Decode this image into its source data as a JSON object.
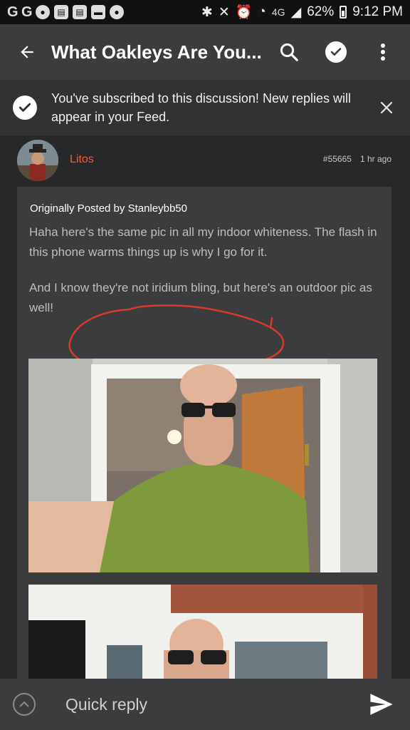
{
  "status_bar": {
    "left_letters": [
      "G",
      "G"
    ],
    "notification_icons": [
      "b",
      "reddit-icon",
      "calendar-icon",
      "calendar-icon",
      "message-icon",
      "reddit-icon"
    ],
    "network_label": "4G",
    "battery": "62%",
    "time": "9:12 PM"
  },
  "app_bar": {
    "title": "What Oakleys Are You...",
    "icons": [
      "back-arrow-icon",
      "search-icon",
      "check-circle-icon",
      "more-vert-icon"
    ]
  },
  "banner": {
    "text": "You've subscribed to this discussion! New replies will appear in your Feed."
  },
  "post": {
    "username": "Litos",
    "post_number": "#55665",
    "time_ago": "1 hr ago",
    "quote": {
      "author_line": "Originally Posted by Stanleybb50",
      "paragraph1": "Haha here's the same pic in all my indoor whiteness. The flash in this phone warms things up is why I go for it.",
      "paragraph2": "And I know they're not iridium bling, but here's an outdoor pic as well!"
    }
  },
  "quick_reply": {
    "placeholder": "Quick reply"
  },
  "colors": {
    "accent_username": "#e8613a",
    "app_bar": "#3a3c3e",
    "background": "#222426",
    "scribble": "#d83a2a"
  }
}
